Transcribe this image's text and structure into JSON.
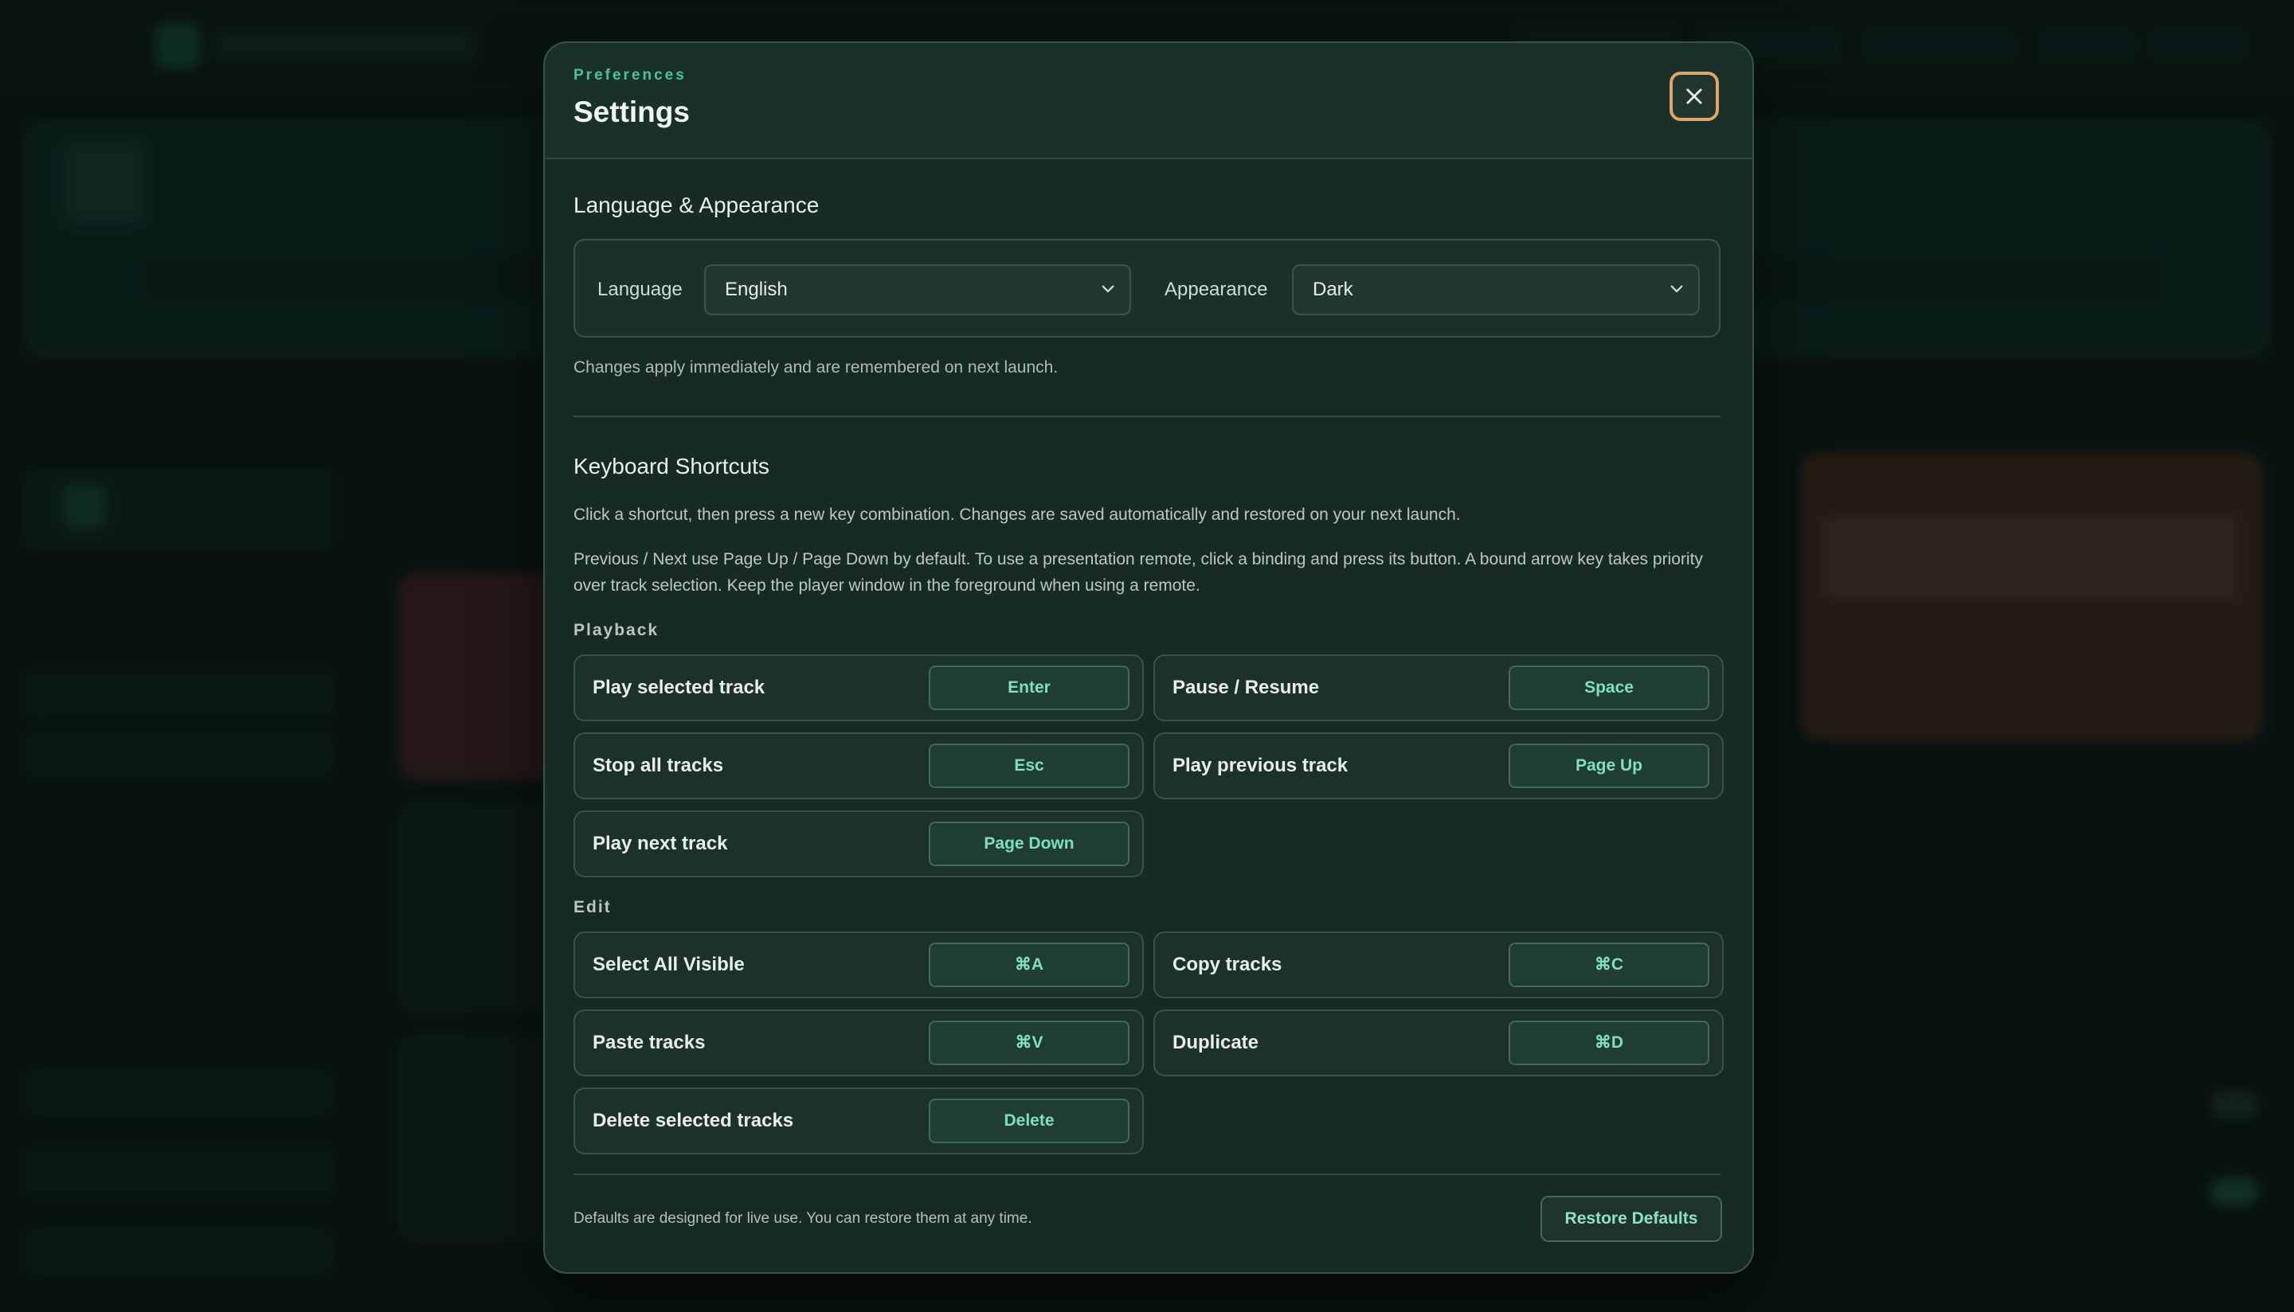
{
  "header": {
    "eyebrow": "Preferences",
    "title": "Settings",
    "close_icon": "close-icon"
  },
  "language_appearance": {
    "title": "Language & Appearance",
    "language_label": "Language",
    "language_value": "English",
    "appearance_label": "Appearance",
    "appearance_value": "Dark",
    "note": "Changes apply immediately and are remembered on next launch."
  },
  "keyboard": {
    "title": "Keyboard Shortcuts",
    "intro": "Click a shortcut, then press a new key combination. Changes are saved automatically and restored on your next launch.",
    "remote_note": "Previous / Next use Page Up / Page Down by default. To use a presentation remote, click a binding and press its button. A bound arrow key takes priority over track selection. Keep the player window in the foreground when using a remote.",
    "playback_label": "Playback",
    "playback": [
      {
        "name": "Play selected track",
        "key": "Enter"
      },
      {
        "name": "Pause / Resume",
        "key": "Space"
      },
      {
        "name": "Stop all tracks",
        "key": "Esc"
      },
      {
        "name": "Play previous track",
        "key": "Page Up"
      },
      {
        "name": "Play next track",
        "key": "Page Down"
      }
    ],
    "edit_label": "Edit",
    "edit": [
      {
        "name": "Select All Visible",
        "key": "⌘A"
      },
      {
        "name": "Copy tracks",
        "key": "⌘C"
      },
      {
        "name": "Paste tracks",
        "key": "⌘V"
      },
      {
        "name": "Duplicate",
        "key": "⌘D"
      },
      {
        "name": "Delete selected tracks",
        "key": "Delete"
      }
    ]
  },
  "footer": {
    "note": "Defaults are designed for live use. You can restore them at any time.",
    "restore_label": "Restore Defaults"
  },
  "colors": {
    "accent": "#4cc29a",
    "focus_ring": "#e3a46a",
    "modal_bg": "#172a24"
  }
}
